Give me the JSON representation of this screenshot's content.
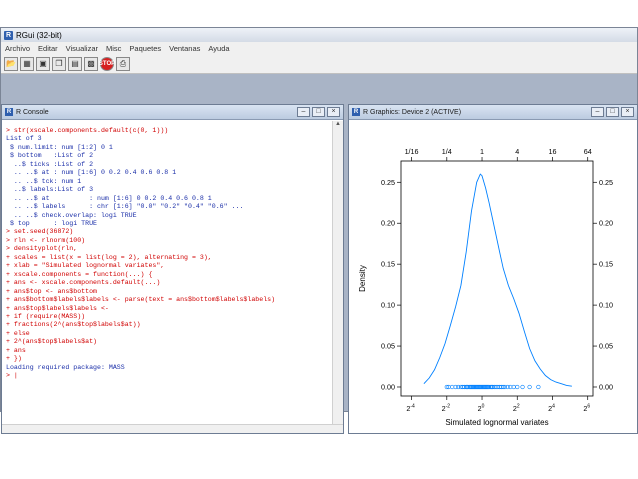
{
  "app": {
    "title": "RGui (32-bit)",
    "menu": [
      "Archivo",
      "Editar",
      "Visualizar",
      "Misc",
      "Paquetes",
      "Ventanas",
      "Ayuda"
    ],
    "toolbar_icons": [
      "open-script-icon",
      "load-workspace-icon",
      "save-icon",
      "copy-icon",
      "paste-icon",
      "copy-paste-icon",
      "stop-icon",
      "print-icon"
    ]
  },
  "console": {
    "title": "R Console",
    "lines": [
      {
        "text": "> str(xscale.components.default(c(0, 1)))",
        "color": "red"
      },
      {
        "text": "List of 3",
        "color": "blue"
      },
      {
        "text": " $ num.limit: num [1:2] 0 1",
        "color": "blue"
      },
      {
        "text": " $ bottom   :List of 2",
        "color": "blue"
      },
      {
        "text": "  ..$ ticks :List of 2",
        "color": "blue"
      },
      {
        "text": "  .. ..$ at : num [1:6] 0 0.2 0.4 0.6 0.8 1",
        "color": "blue"
      },
      {
        "text": "  .. ..$ tck: num 1",
        "color": "blue"
      },
      {
        "text": "  ..$ labels:List of 3",
        "color": "blue"
      },
      {
        "text": "  .. ..$ at          : num [1:6] 0 0.2 0.4 0.6 0.8 1",
        "color": "blue"
      },
      {
        "text": "  .. ..$ labels      : chr [1:6] \"0.0\" \"0.2\" \"0.4\" \"0.6\" ...",
        "color": "blue"
      },
      {
        "text": "  .. ..$ check.overlap: logi TRUE",
        "color": "blue"
      },
      {
        "text": " $ top      : logi TRUE",
        "color": "blue"
      },
      {
        "text": "> set.seed(36872)",
        "color": "red"
      },
      {
        "text": "> rln <- rlnorm(100)",
        "color": "red"
      },
      {
        "text": "> densityplot(rln,",
        "color": "red"
      },
      {
        "text": "+ scales = list(x = list(log = 2), alternating = 3),",
        "color": "red"
      },
      {
        "text": "+ xlab = \"Simulated lognormal variates\",",
        "color": "red"
      },
      {
        "text": "+ xscale.components = function(...) {",
        "color": "red"
      },
      {
        "text": "+ ans <- xscale.components.default(...)",
        "color": "red"
      },
      {
        "text": "+ ans$top <- ans$bottom",
        "color": "red"
      },
      {
        "text": "+ ans$bottom$labels$labels <- parse(text = ans$bottom$labels$labels)",
        "color": "red"
      },
      {
        "text": "+ ans$top$labels$labels <-",
        "color": "red"
      },
      {
        "text": "+ if (require(MASS))",
        "color": "red"
      },
      {
        "text": "+ fractions(2^(ans$top$labels$at))",
        "color": "red"
      },
      {
        "text": "+ else",
        "color": "red"
      },
      {
        "text": "+ 2^(ans$top$labels$at)",
        "color": "red"
      },
      {
        "text": "+ ans",
        "color": "red"
      },
      {
        "text": "+ })",
        "color": "red"
      },
      {
        "text": "Loading required package: MASS",
        "color": "blue"
      },
      {
        "text": "> |",
        "color": "red"
      }
    ]
  },
  "graphics": {
    "title": "R Graphics: Device 2 (ACTIVE)"
  },
  "chart_data": {
    "type": "line",
    "xlabel": "Simulated lognormal variates",
    "ylabel": "Density",
    "xscale": "log2",
    "xlim": [
      -4.6,
      6.3
    ],
    "ylim": [
      -0.011,
      0.276
    ],
    "x_ticks_bottom": [
      {
        "exp": -4,
        "base": "2",
        "sup": "-4"
      },
      {
        "exp": -2,
        "base": "2",
        "sup": "-2"
      },
      {
        "exp": 0,
        "base": "2",
        "sup": "0"
      },
      {
        "exp": 2,
        "base": "2",
        "sup": "2"
      },
      {
        "exp": 4,
        "base": "2",
        "sup": "4"
      },
      {
        "exp": 6,
        "base": "2",
        "sup": "6"
      }
    ],
    "x_ticks_top": [
      {
        "exp": -4,
        "label": "1/16"
      },
      {
        "exp": -2,
        "label": "1/4"
      },
      {
        "exp": 0,
        "label": "1"
      },
      {
        "exp": 2,
        "label": "4"
      },
      {
        "exp": 4,
        "label": "16"
      },
      {
        "exp": 6,
        "label": "64"
      }
    ],
    "y_ticks": [
      {
        "value": 0.0,
        "label": "0.00"
      },
      {
        "value": 0.05,
        "label": "0.05"
      },
      {
        "value": 0.1,
        "label": "0.10"
      },
      {
        "value": 0.15,
        "label": "0.15"
      },
      {
        "value": 0.2,
        "label": "0.20"
      },
      {
        "value": 0.25,
        "label": "0.25"
      }
    ],
    "density": {
      "x": [
        -3.3,
        -3.0,
        -2.7,
        -2.4,
        -2.1,
        -1.8,
        -1.5,
        -1.2,
        -0.9,
        -0.6,
        -0.3,
        -0.1,
        0.0,
        0.2,
        0.4,
        0.6,
        0.8,
        1.0,
        1.2,
        1.5,
        1.8,
        2.1,
        2.4,
        2.7,
        3.0,
        3.3,
        3.6,
        3.9,
        4.2,
        4.5,
        4.8,
        5.1
      ],
      "y": [
        0.004,
        0.011,
        0.021,
        0.036,
        0.053,
        0.075,
        0.098,
        0.124,
        0.165,
        0.215,
        0.25,
        0.26,
        0.258,
        0.243,
        0.225,
        0.205,
        0.185,
        0.165,
        0.145,
        0.124,
        0.108,
        0.09,
        0.068,
        0.047,
        0.032,
        0.022,
        0.014,
        0.009,
        0.006,
        0.004,
        0.002,
        0.001
      ]
    },
    "rug_points": {
      "x": [
        -2.0,
        -1.9,
        -1.7,
        -1.5,
        -1.35,
        -1.2,
        -1.1,
        -1.0,
        -0.9,
        -0.85,
        -0.8,
        -0.7,
        -0.65,
        -0.6,
        -0.55,
        -0.5,
        -0.45,
        -0.4,
        -0.35,
        -0.3,
        -0.25,
        -0.2,
        -0.15,
        -0.1,
        -0.05,
        0.0,
        0.05,
        0.1,
        0.15,
        0.2,
        0.25,
        0.3,
        0.35,
        0.4,
        0.5,
        0.55,
        0.6,
        0.7,
        0.8,
        0.9,
        1.0,
        1.1,
        1.2,
        1.3,
        1.45,
        1.6,
        1.8,
        2.0,
        2.3,
        2.7,
        3.2
      ],
      "y": 0
    },
    "line_color": "#0080ff",
    "point_color": "#0080ff",
    "grid": false
  }
}
